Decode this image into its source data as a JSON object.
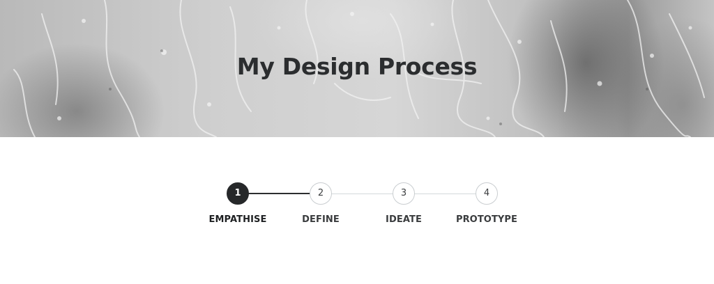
{
  "hero": {
    "title": "My Design Process",
    "background_image": "rain-on-glass-photo"
  },
  "stepper": {
    "active_step": 1,
    "steps": [
      {
        "number": "1",
        "label": "EMPATHISE"
      },
      {
        "number": "2",
        "label": "DEFINE"
      },
      {
        "number": "3",
        "label": "IDEATE"
      },
      {
        "number": "4",
        "label": "PROTOTYPE"
      }
    ]
  },
  "colors": {
    "active": "#26282a",
    "inactive_border": "#c9cdd0",
    "connector": "#d4d8da",
    "text": "#3a3c3e"
  }
}
